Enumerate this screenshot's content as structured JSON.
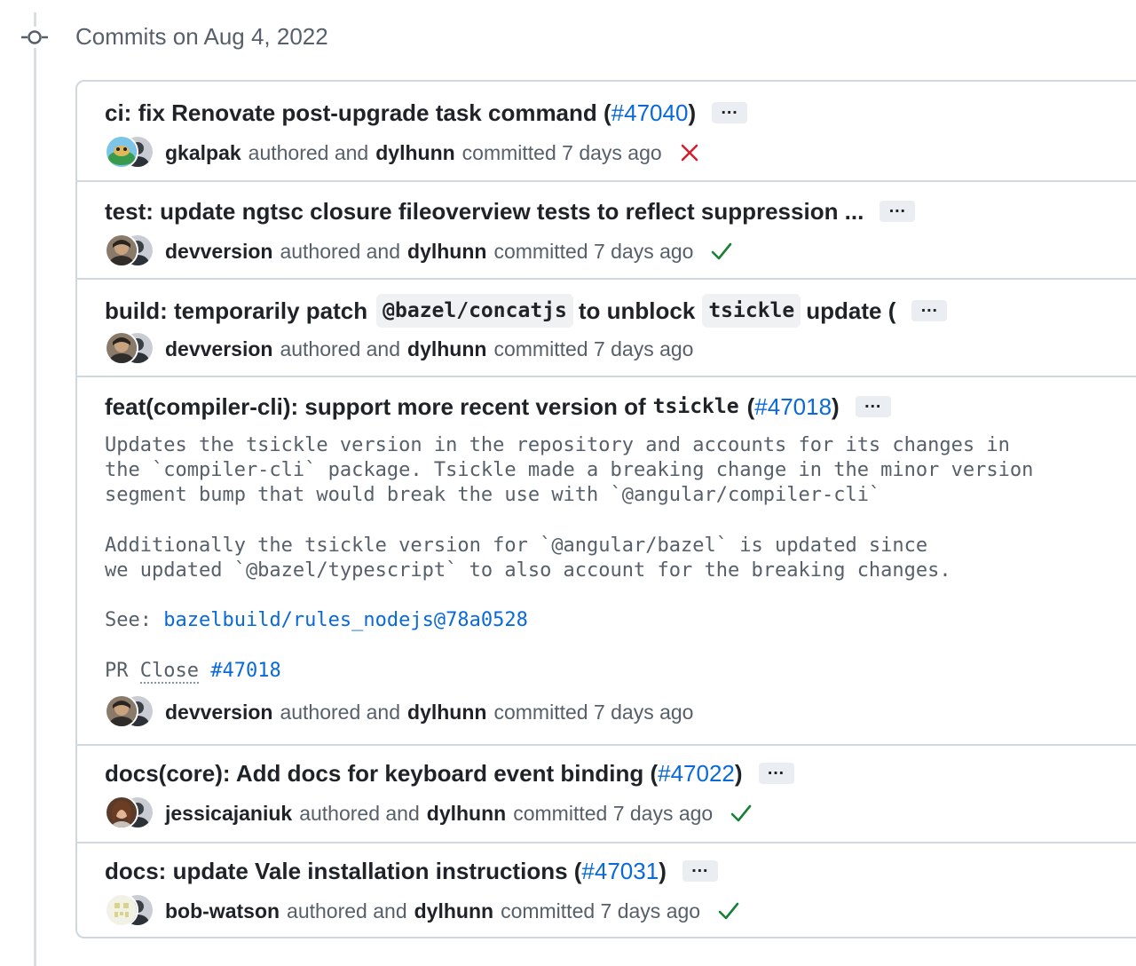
{
  "group": {
    "header": "Commits on Aug 4, 2022"
  },
  "commits": [
    {
      "title_prefix": "ci: fix Renovate post-upgrade task command (",
      "pr": "#47040",
      "title_suffix": ")",
      "author": "gkalpak",
      "authored_text": "authored and",
      "committer": "dylhunn",
      "committed_text": "committed 7 days ago",
      "status": "failure"
    },
    {
      "title_prefix": "test: update ngtsc closure fileoverview tests to reflect suppression ...",
      "author": "devversion",
      "authored_text": "authored and",
      "committer": "dylhunn",
      "committed_text": "committed 7 days ago",
      "status": "success"
    },
    {
      "title_part1": "build: temporarily patch",
      "code1": "@bazel/concatjs",
      "title_part2": "to unblock",
      "code2": "tsickle",
      "title_part3": "update (",
      "author": "devversion",
      "authored_text": "authored and",
      "committer": "dylhunn",
      "committed_text": "committed 7 days ago",
      "status": "none"
    },
    {
      "title_prefix": "feat(compiler-cli): support more recent version of",
      "code": "tsickle",
      "title_mid": "(",
      "pr": "#47018",
      "title_suffix": ")",
      "body": {
        "line1": "Updates the tsickle version in the repository and accounts for its changes in",
        "line2": "the `compiler-cli` package. Tsickle made a breaking change in the minor version",
        "line3": "segment bump that would break the use with `@angular/compiler-cli`",
        "line4": "Additionally the tsickle version for `@angular/bazel` is updated since",
        "line5": "we updated `@bazel/typescript` to also account for the breaking changes.",
        "see_label": "See: ",
        "see_link": "bazelbuild/rules_nodejs@78a0528",
        "pr_label": "PR",
        "close_label": "Close",
        "close_link": "#47018"
      },
      "author": "devversion",
      "authored_text": "authored and",
      "committer": "dylhunn",
      "committed_text": "committed 7 days ago",
      "status": "none"
    },
    {
      "title_prefix": "docs(core): Add docs for keyboard event binding (",
      "pr": "#47022",
      "title_suffix": ")",
      "author": "jessicajaniuk",
      "authored_text": "authored and",
      "committer": "dylhunn",
      "committed_text": "committed 7 days ago",
      "status": "success"
    },
    {
      "title_prefix": "docs: update Vale installation instructions (",
      "pr": "#47031",
      "title_suffix": ")",
      "author": "bob-watson",
      "authored_text": "authored and",
      "committer": "dylhunn",
      "committed_text": "committed 7 days ago",
      "status": "success"
    }
  ],
  "ellipsis_label": "…",
  "colors": {
    "link": "#0969da",
    "success": "#1a7f37",
    "failure": "#cf222e",
    "border": "#d0d7de"
  }
}
